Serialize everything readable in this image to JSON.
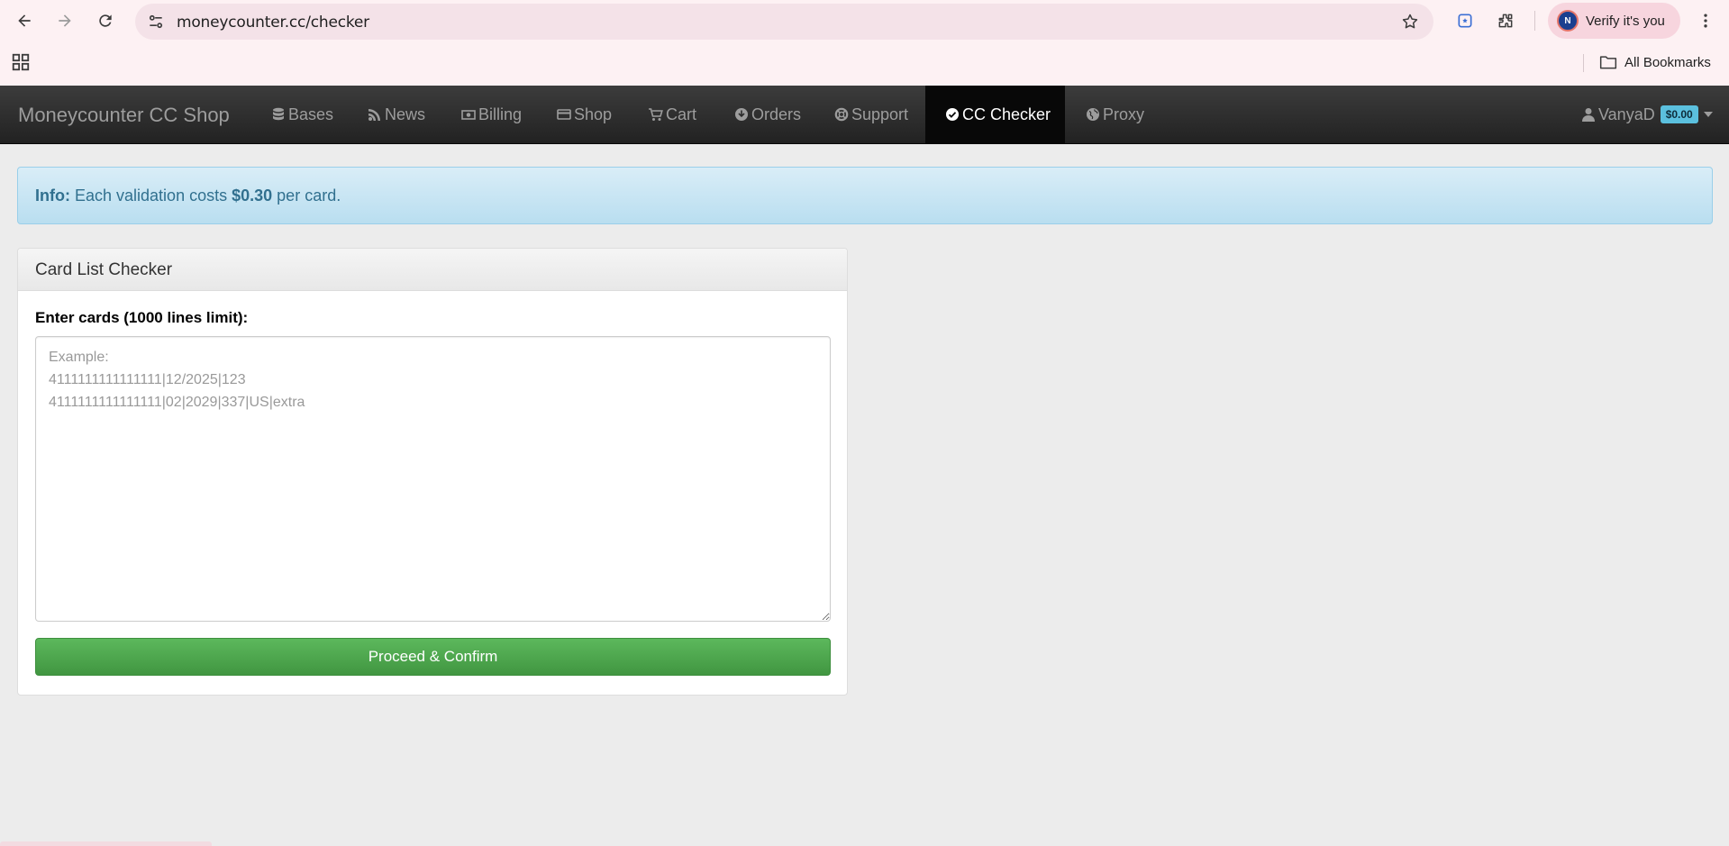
{
  "browser": {
    "url": "moneycounter.cc/checker",
    "verify_label": "Verify it's you",
    "verify_avatar_letter": "N",
    "all_bookmarks_label": "All Bookmarks"
  },
  "navbar": {
    "brand": "Moneycounter CC Shop",
    "items": [
      {
        "label": "Bases",
        "icon": "database-icon"
      },
      {
        "label": "News",
        "icon": "rss-icon"
      },
      {
        "label": "Billing",
        "icon": "money-icon"
      },
      {
        "label": "Shop",
        "icon": "credit-card-icon"
      },
      {
        "label": "Cart",
        "icon": "cart-icon"
      },
      {
        "label": "Orders",
        "icon": "download-circle-icon"
      },
      {
        "label": "Support",
        "icon": "lifebuoy-icon"
      },
      {
        "label": "CC Checker",
        "icon": "check-circle-icon",
        "active": true
      },
      {
        "label": "Proxy",
        "icon": "globe-icon"
      }
    ],
    "user": {
      "name": "VanyaD",
      "balance": "$0.00"
    }
  },
  "alert": {
    "prefix": "Info:",
    "text_before": "Each validation costs",
    "amount": "$0.30",
    "text_after": "per card."
  },
  "checker": {
    "panel_title": "Card List Checker",
    "field_label": "Enter cards (1000 lines limit):",
    "placeholder": "Example:\n4111111111111111|12/2025|123\n4111111111111111|02|2029|337|US|extra",
    "submit_label": "Proceed & Confirm"
  },
  "colors": {
    "navbar_bg": "#222222",
    "alert_bg": "#d9edf7",
    "success_button": "#5cb85c",
    "badge": "#5bc0de"
  }
}
